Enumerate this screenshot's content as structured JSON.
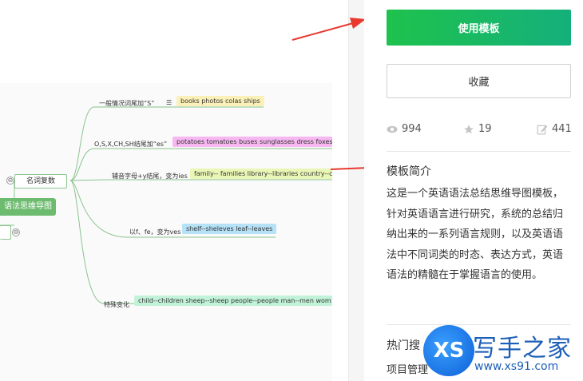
{
  "mindmap": {
    "root_label": "语法思维导图",
    "level1_label": "名词复数",
    "branches": [
      {
        "rule": "一般情况词尾加“S”",
        "example": "books photos colas ships",
        "color": "#fbf1b8"
      },
      {
        "rule": "O,S,X,CH,SH结尾加“es”",
        "example": "potatoes tomatoes buses sunglasses dress foxes s",
        "color": "#f7b8f2"
      },
      {
        "rule": "辅音字母+y结尾，变为ies",
        "example": "family-- families library--libraries country--c",
        "color": "#e8f7b5"
      },
      {
        "rule": "以f、fe，变为ves",
        "example": "shelf--sheleves leaf--leaves",
        "color": "#b6e2f8"
      },
      {
        "rule": "特殊变化",
        "example": "child--children sheep--sheep people--people man--men wom",
        "color": "#c2f3d8"
      }
    ],
    "collapse_symbol": "⊖"
  },
  "actions": {
    "use_template_label": "使用模板",
    "favorite_label": "收藏"
  },
  "stats": {
    "views": "994",
    "likes": "19",
    "edits": "441"
  },
  "intro": {
    "title": "模板简介",
    "text": "这是一个英语语法总结思维导图模板，针对英语语言进行研究，系统的总结归纳出来的一系列语言规则，以及英语语法中不同词类的时态、表达方式，英语语法的精髓在于掌握语言的使用。"
  },
  "hot_search": {
    "title": "热门搜",
    "first_item": "项目管理"
  },
  "watermark": {
    "logo_text": "XS",
    "chinese": "写手之家",
    "url": "www.xs91.com"
  },
  "colors": {
    "primary_gradient_start": "#1ec24c",
    "primary_gradient_end": "#14b07c",
    "mindmap_green": "#6dbb6f",
    "annotation_red": "#e8392f"
  },
  "icons": [
    "eye-icon",
    "star-icon",
    "edit-icon",
    "arrow-icon"
  ]
}
